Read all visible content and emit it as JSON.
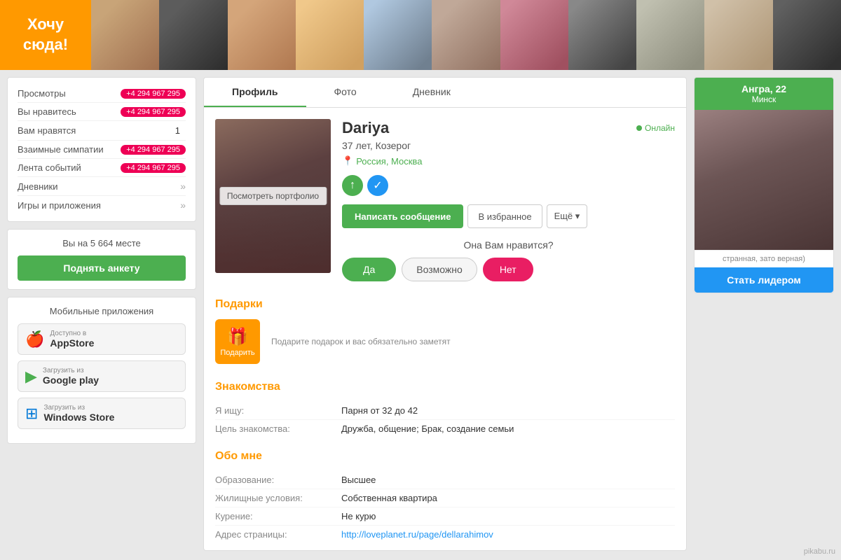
{
  "banner": {
    "want_text": "Хочу\nсюда!",
    "avatars": [
      {
        "class": "face1"
      },
      {
        "class": "face2"
      },
      {
        "class": "face3"
      },
      {
        "class": "face4"
      },
      {
        "class": "face5"
      },
      {
        "class": "face6"
      },
      {
        "class": "face7"
      },
      {
        "class": "face8"
      },
      {
        "class": "face9"
      },
      {
        "class": "face10"
      },
      {
        "class": "face11"
      }
    ]
  },
  "sidebar": {
    "stats": [
      {
        "label": "Просмотры",
        "value": "+4 294 967 295",
        "type": "badge"
      },
      {
        "label": "Вы нравитесь",
        "value": "+4 294 967 295",
        "type": "badge"
      },
      {
        "label": "Вам нравятся",
        "value": "1",
        "type": "plain"
      },
      {
        "label": "Взаимные симпатии",
        "value": "+4 294 967 295",
        "type": "badge"
      },
      {
        "label": "Лента событий",
        "value": "+4 294 967 295",
        "type": "badge"
      },
      {
        "label": "Дневники",
        "value": "»",
        "type": "arrow"
      },
      {
        "label": "Игры и приложения",
        "value": "»",
        "type": "arrow"
      }
    ],
    "rank": {
      "text": "Вы на 5 664 месте",
      "btn_label": "Поднять анкету"
    },
    "apps": {
      "title": "Мобильные приложения",
      "items": [
        {
          "icon": "🍎",
          "sub": "Доступно в",
          "name": "AppStore"
        },
        {
          "icon": "▶",
          "sub": "Загрузить из",
          "name": "Google play"
        },
        {
          "icon": "⊞",
          "sub": "Загрузить из",
          "name": "Windows Store"
        }
      ]
    }
  },
  "profile": {
    "tabs": [
      "Профиль",
      "Фото",
      "Дневник"
    ],
    "active_tab": "Профиль",
    "photo_overlay": "Посмотреть портфолио",
    "name": "Dariya",
    "online_text": "Онлайн",
    "age_text": "37 лет, Козерог",
    "location": "Россия, Москва",
    "write_btn": "Написать сообщение",
    "fav_btn": "В избранное",
    "more_btn": "Ещё ▾",
    "like_question": "Она Вам нравится?",
    "btn_yes": "Да",
    "btn_maybe": "Возможно",
    "btn_no": "Нет",
    "gifts_title": "Подарки",
    "gift_btn_label": "Подарить",
    "gift_text": "Подарите подарок и вас обязательно заметят",
    "dating_title": "Знакомства",
    "dating": [
      {
        "key": "Я ищу:",
        "val": "Парня от 32 до 42"
      },
      {
        "key": "Цель знакомства:",
        "val": "Дружба, общение; Брак, создание семьи"
      }
    ],
    "about_title": "Обо мне",
    "about": [
      {
        "key": "Образование:",
        "val": "Высшее"
      },
      {
        "key": "Жилищные условия:",
        "val": "Собственная квартира"
      },
      {
        "key": "Курение:",
        "val": "Не курю"
      },
      {
        "key": "Адрес страницы:",
        "val": "http://loveplanet.ru/page/dellarahimov"
      }
    ]
  },
  "right_sidebar": {
    "promo_name": "Ангра, 22",
    "promo_city": "Минск",
    "promo_caption": "странная, зато верная)",
    "leader_btn": "Стать лидером"
  },
  "watermark": "pikabu.ru"
}
